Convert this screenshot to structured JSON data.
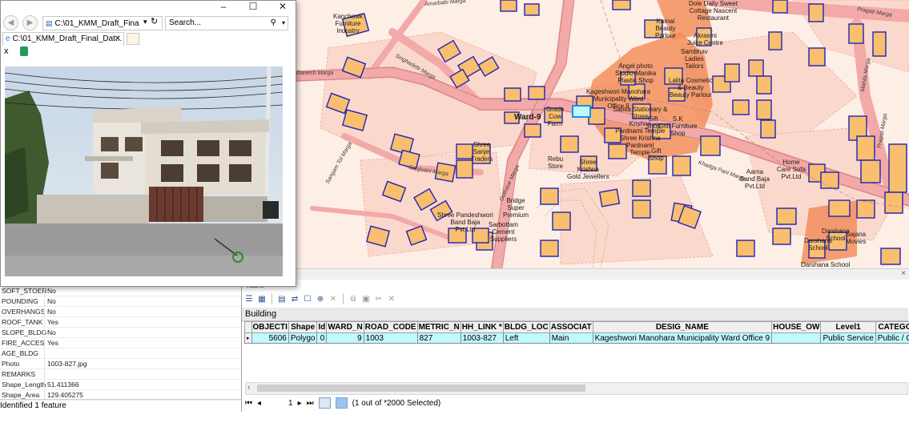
{
  "browser": {
    "address": "C:\\01_KMM_Draft_Fina",
    "search_placeholder": "Search...",
    "tab_title": "C:\\01_KMM_Draft_Final_Dat...",
    "close_char": "×"
  },
  "map": {
    "ward_label": "Ward-9",
    "labels": [
      {
        "text": "Kanchowk\nFurniture\nIndustry"
      },
      {
        "text": "Dole Daily Sweet\nCottage Nascent\nRestaurant"
      },
      {
        "text": "Kamal\nBeauty\nParlour"
      },
      {
        "text": "Akrasmi\nJuice Centre"
      },
      {
        "text": "Sambhav\nLadies\nTailors"
      },
      {
        "text": "Angel photo\nStudio-Manika\nPlastic Shop"
      },
      {
        "text": "Lalita Cosmetic\n& Beauty\nBeauty Parlour"
      },
      {
        "text": "Kageshwori Manohara\nMunicipality Ward\nOffice 9"
      },
      {
        "text": "Sabita Stationary &\nShree\nKrishna\nPardnami Temple\nShree Krishna\nPardnami\nTemple"
      },
      {
        "text": "Gift\nShop"
      },
      {
        "text": "S.K\nGrill Furniture\nShop"
      },
      {
        "text": "Gift\nShop"
      },
      {
        "text": "Grade\nCow\nFarm"
      },
      {
        "text": "Shree\nSanjel\nTraders"
      },
      {
        "text": "Rebu\nStore"
      },
      {
        "text": "Shree\nKrishna\nGold Jewellers"
      },
      {
        "text": "Home\nCare Sofa\nPvt.Ltd"
      },
      {
        "text": "Aarna\nBand Baja\nPvt.Ltd"
      },
      {
        "text": "Bridge\nSuper\nPremium"
      },
      {
        "text": "Shree Pandeshwori\nBand Baja\nPvt.Ltd"
      },
      {
        "text": "Sarbottam\nCement\nSuppliers"
      },
      {
        "text": "Darshana\nSchool"
      },
      {
        "text": "Darshana\nSchool"
      },
      {
        "text": "Sajana\nMovies"
      },
      {
        "text": "Darshana School"
      }
    ],
    "road_labels": [
      "Amarbabi Marga",
      "Singhadebi Marga",
      "Ganesh Marga",
      "Pragati Marga",
      "Sangam Tol Marga",
      "Sanjivani Marga",
      "Gothatar Marga",
      "Khadga Pani Marga",
      "Mahila Marga",
      "Pragati Marga"
    ]
  },
  "identify": {
    "rows": [
      {
        "key": "SOFT_STOER",
        "value": "No"
      },
      {
        "key": "POUNDING",
        "value": "No"
      },
      {
        "key": "OVERHANGS",
        "value": "No"
      },
      {
        "key": "ROOF_TANK",
        "value": "Yes"
      },
      {
        "key": "SLOPE_BLDG",
        "value": "No"
      },
      {
        "key": "FIRE_ACCES",
        "value": "Yes"
      },
      {
        "key": "AGE_BLDG",
        "value": ""
      },
      {
        "key": "Photo",
        "value": "1003-827.jpg"
      },
      {
        "key": "REMARKS",
        "value": ""
      },
      {
        "key": "Shape_Length",
        "value": "51.411366"
      },
      {
        "key": "Shape_Area",
        "value": "129.405275"
      }
    ],
    "status": "Identified 1 feature"
  },
  "table": {
    "title": "Table",
    "layer_tab": "Building",
    "columns": [
      "OBJECTI",
      "Shape",
      "Id",
      "WARD_N",
      "ROAD_CODE",
      "METRIC_N",
      "HH_LINK *",
      "BLDG_LOC",
      "ASSOCIAT",
      "DESIG_NAME",
      "HOUSE_OW",
      "Level1",
      "CATEGO",
      ""
    ],
    "row": [
      "5606",
      "Polygo",
      "0",
      "9",
      "1003",
      "827",
      "1003-827",
      "Left",
      "Main",
      "Kageshwori Manohara Municipality Ward Office 9",
      "",
      "Public Service",
      "Public / G",
      "G"
    ],
    "nav_record": "1",
    "selection_status": "(1 out of *2000 Selected)"
  },
  "colors": {
    "building_fill": "#f9bf6e",
    "building_stroke": "#1d24b8",
    "road_fill": "#f2a8a6",
    "parcel_fill": "#fbd4c8",
    "selection_cyan": "#bff8ff",
    "hotspot": "#f1824b"
  }
}
